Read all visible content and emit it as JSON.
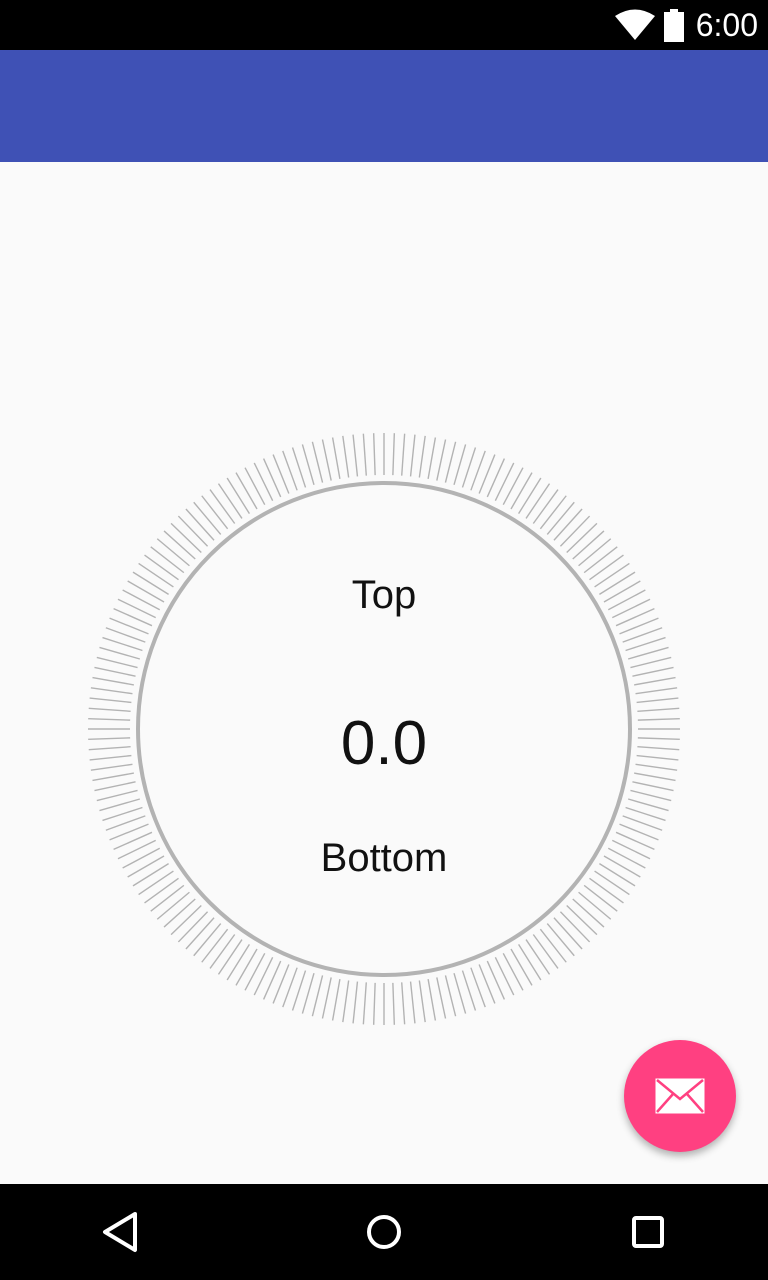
{
  "status_bar": {
    "time": "6:00",
    "icons": [
      "wifi-icon",
      "battery-icon"
    ]
  },
  "app_bar": {
    "color": "#3f51b5"
  },
  "dial": {
    "top_label": "Top",
    "value": "0.0",
    "bottom_label": "Bottom",
    "tick_count": 180,
    "ring_color": "#b3b3b3"
  },
  "fab": {
    "icon": "mail-icon",
    "color": "#ff4081"
  },
  "nav_bar": {
    "icons": [
      "back-icon",
      "home-icon",
      "recents-icon"
    ]
  }
}
